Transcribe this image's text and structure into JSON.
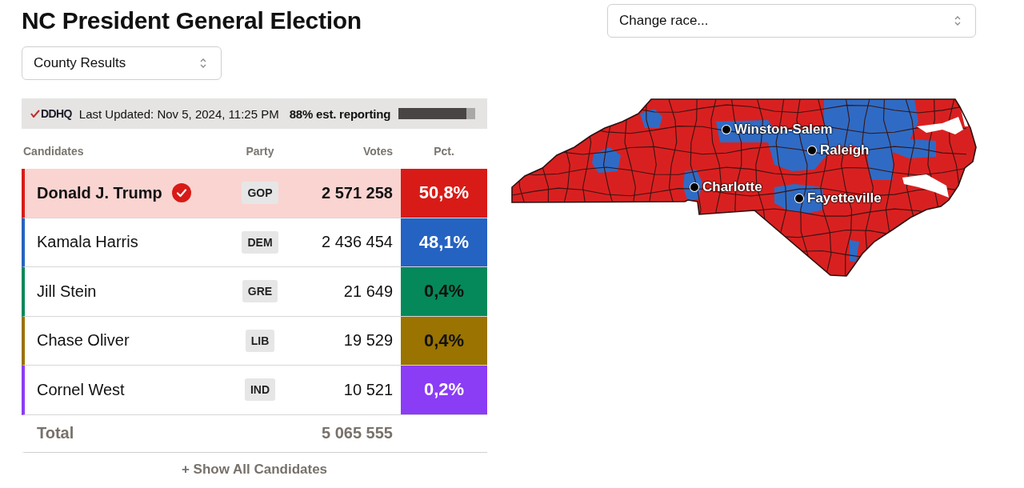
{
  "title": "NC President General Election",
  "view_select": {
    "value": "County Results"
  },
  "race_select": {
    "placeholder": "Change race..."
  },
  "status_bar": {
    "logo": "DDHQ",
    "updated": "Last Updated: Nov 5, 2024, 11:25 PM",
    "reporting": "88% est. reporting",
    "level": 0.88
  },
  "table": {
    "columns": [
      "Candidates",
      "Party",
      "Votes",
      "Pct."
    ],
    "rows": [
      {
        "name": "Donald J. Trump",
        "winner": true,
        "party": "GOP",
        "votes": "2 571 258",
        "pct": "50,8%",
        "color": "#d81b17"
      },
      {
        "name": "Kamala Harris",
        "winner": false,
        "party": "DEM",
        "votes": "2 436 454",
        "pct": "48,1%",
        "color": "#2563c2"
      },
      {
        "name": "Jill Stein",
        "winner": false,
        "party": "GRE",
        "votes": "21 649",
        "pct": "0,4%",
        "color": "#05895a"
      },
      {
        "name": "Chase Oliver",
        "winner": false,
        "party": "LIB",
        "votes": "19 529",
        "pct": "0,4%",
        "color": "#9a7300"
      },
      {
        "name": "Cornel West",
        "winner": false,
        "party": "IND",
        "votes": "10 521",
        "pct": "0,2%",
        "color": "#8b3cf5"
      }
    ],
    "total": {
      "label": "Total",
      "votes": "5 065 555"
    },
    "show_all": "+ Show All Candidates"
  },
  "map": {
    "cities": [
      {
        "name": "Winston-Salem"
      },
      {
        "name": "Raleigh"
      },
      {
        "name": "Charlotte"
      },
      {
        "name": "Fayetteville"
      }
    ]
  }
}
